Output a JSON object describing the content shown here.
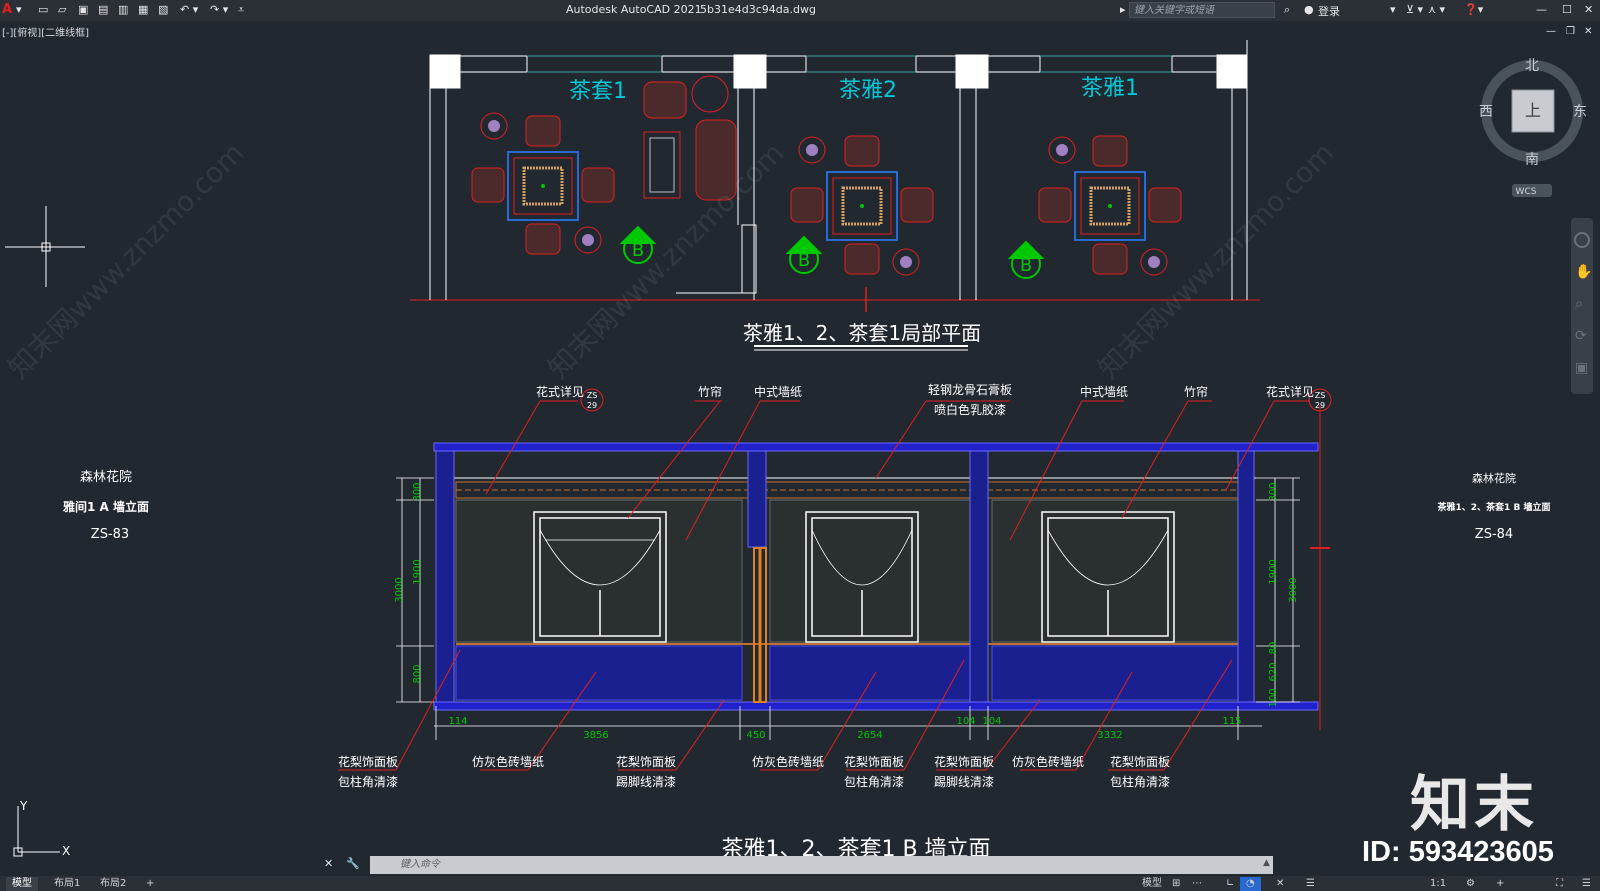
{
  "app": {
    "title": "Autodesk AutoCAD 2021",
    "filename": "5b31e4d3c94da.dwg",
    "search_placeholder": "键入关键字或短语",
    "login_label": "登录",
    "viewport_label": "[-][俯视][二维线框]"
  },
  "viewcube": {
    "north": "北",
    "south": "南",
    "east": "东",
    "west": "西",
    "face": "上",
    "wcs": "WCS"
  },
  "drawing": {
    "plan": {
      "rooms": [
        "茶套1",
        "茶雅2",
        "茶雅1"
      ],
      "title": "茶雅1、2、茶套1局部平面",
      "section_marker": "B"
    },
    "elevation": {
      "title": "茶雅1、2、茶套1 B 墙立面",
      "top_callouts": [
        "花式详见",
        "竹帘",
        "中式墙纸",
        "轻钢龙骨石膏板",
        "喷白色乳胶漆",
        "中式墙纸",
        "竹帘",
        "花式详见"
      ],
      "zs_tag": "ZS",
      "zs_num": "29",
      "bottom_callouts": [
        [
          "花梨饰面板",
          "包柱角清漆"
        ],
        [
          "仿灰色砖墙纸",
          ""
        ],
        [
          "花梨饰面板",
          "踢脚线清漆"
        ],
        [
          "仿灰色砖墙纸",
          ""
        ],
        [
          "花梨饰面板",
          "包柱角清漆"
        ],
        [
          "花梨饰面板",
          "踢脚线清漆"
        ],
        [
          "仿灰色砖墙纸",
          ""
        ],
        [
          "花梨饰面板",
          "包柱角清漆"
        ]
      ],
      "dims_bottom": [
        "114",
        "3856",
        "450",
        "2654",
        "104",
        "104",
        "3332",
        "115"
      ],
      "dims_left": [
        "300",
        "1900",
        "800",
        "3000"
      ],
      "dims_right": [
        "300",
        "1900",
        "80",
        "620",
        "100",
        "3000"
      ]
    },
    "left_label": {
      "project": "森林花院",
      "name": "雅间1 A 墙立面",
      "code": "ZS-83"
    },
    "right_label": {
      "project": "森林花院",
      "name": "茶雅1、2、茶套1 B 墙立面",
      "code": "ZS-84"
    }
  },
  "command": {
    "placeholder": "键入命令"
  },
  "tabs": [
    "模型",
    "布局1",
    "布局2",
    "+"
  ],
  "status": {
    "model": "模型",
    "scale": "1:1"
  },
  "watermark": {
    "brand": "知末",
    "id": "ID: 593423605",
    "text": "知末网www.znzmo.com"
  },
  "colors": {
    "background": "#212830",
    "cyan": "#00c8d8",
    "red": "#e02020",
    "blue": "#2222cc",
    "green": "#00c800",
    "orange": "#d07020"
  }
}
